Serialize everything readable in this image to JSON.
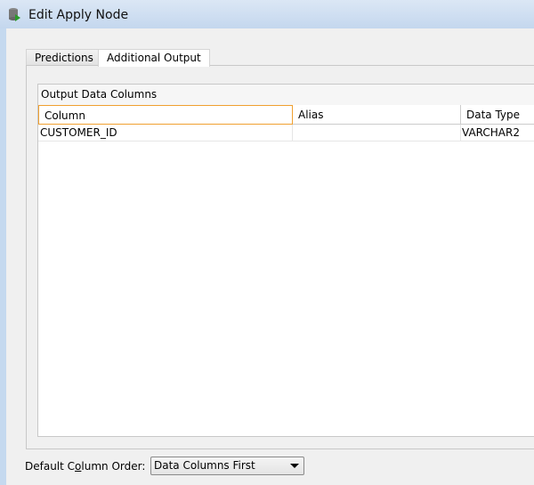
{
  "window": {
    "title": "Edit Apply Node",
    "icon": "database-apply-icon"
  },
  "tabs": [
    {
      "label": "Predictions",
      "active": false
    },
    {
      "label": "Additional Output",
      "active": true
    }
  ],
  "table": {
    "caption": "Output Data Columns",
    "columns": [
      "Column",
      "Alias",
      "Data Type"
    ],
    "rows": [
      [
        "CUSTOMER_ID",
        "",
        "VARCHAR2"
      ]
    ]
  },
  "order": {
    "label_pre": "Default C",
    "label_mnemonic": "o",
    "label_post": "lumn Order:",
    "value": "Data Columns First"
  },
  "colors": {
    "focus": "#f0a030",
    "titlebar": "#c4d7ee"
  }
}
